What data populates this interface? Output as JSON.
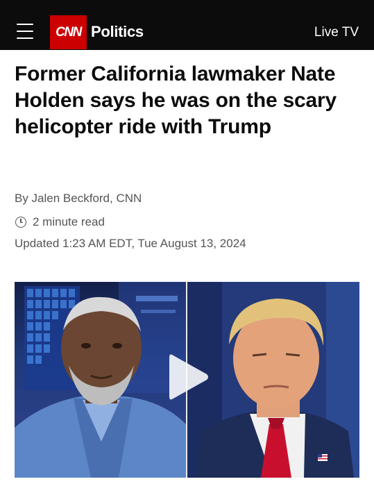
{
  "header": {
    "logo_text": "CNN",
    "section": "Politics",
    "live_tv_label": "Live TV",
    "menu_icon": "hamburger-menu-icon",
    "brand_color": "#cc0000",
    "background_color": "#0c0c0c"
  },
  "article": {
    "headline": "Former California lawmaker Nate Holden says he was on the scary helicopter ride with Trump",
    "byline": "By Jalen Beckford, CNN",
    "read_time": "2 minute read",
    "updated": "Updated 1:23 AM EDT, Tue August 13, 2024",
    "read_time_icon": "clock-icon"
  },
  "media": {
    "type": "video",
    "play_icon": "play-icon"
  }
}
